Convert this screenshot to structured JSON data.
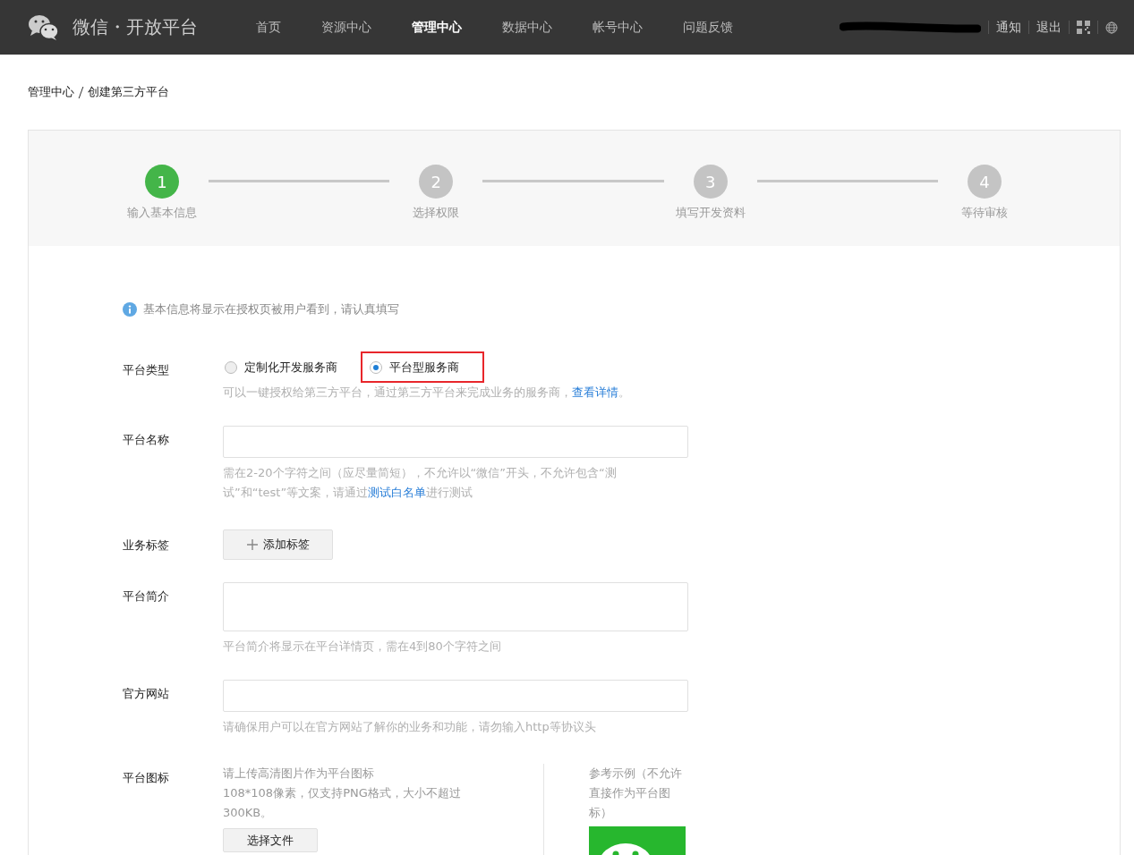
{
  "header": {
    "brand": "微信・开放平台",
    "nav": [
      {
        "label": "首页",
        "selected": false
      },
      {
        "label": "资源中心",
        "selected": false
      },
      {
        "label": "管理中心",
        "selected": true
      },
      {
        "label": "数据中心",
        "selected": false
      },
      {
        "label": "帐号中心",
        "selected": false
      },
      {
        "label": "问题反馈",
        "selected": false
      }
    ],
    "links": [
      "通知",
      "退出"
    ]
  },
  "breadcrumb": [
    "管理中心",
    "创建第三方平台"
  ],
  "steps": [
    {
      "number": "1",
      "label": "输入基本信息",
      "selected": true
    },
    {
      "number": "2",
      "label": "选择权限",
      "selected": false
    },
    {
      "number": "3",
      "label": "填写开发资料",
      "selected": false
    },
    {
      "number": "4",
      "label": "等待审核",
      "selected": false
    }
  ],
  "notice": "基本信息将显示在授权页被用户看到，请认真填写",
  "fields": [
    {
      "kind": "radio",
      "label": "平台类型",
      "options": [
        {
          "label": "定制化开发服务商",
          "selected": false,
          "highlighted": false
        },
        {
          "label": "平台型服务商",
          "selected": true,
          "highlighted": true
        }
      ],
      "hint": [
        {
          "text": "可以一键授权给第三方平台，通过第三方平台来完成业务的服务商，",
          "link": false
        },
        {
          "text": "查看详情",
          "link": true
        },
        {
          "text": "。",
          "link": false
        }
      ]
    },
    {
      "kind": "input",
      "label": "平台名称",
      "hint": [
        {
          "text": "需在2-20个字符之间（应尽量简短），不允许以“微信”开头，不允许包含“测试”和“test”等文案，请通过",
          "link": false
        },
        {
          "text": "测试白名单",
          "link": true
        },
        {
          "text": "进行测试",
          "link": false
        }
      ]
    },
    {
      "kind": "tags",
      "label": "业务标签",
      "button": "添加标签"
    },
    {
      "kind": "textarea",
      "label": "平台简介",
      "hint": [
        {
          "text": "平台简介将显示在平台详情页，需在4到80个字符之间",
          "link": false
        }
      ]
    },
    {
      "kind": "input",
      "label": "官方网站",
      "hint": [
        {
          "text": "请确保用户可以在官方网站了解你的业务和功能，请勿输入http等协议头",
          "link": false
        }
      ]
    },
    {
      "kind": "upload",
      "label": "平台图标",
      "lines": [
        "请上传高清图片作为平台图标",
        "108*108像素，仅支持PNG格式，大小不超过300KB。"
      ],
      "button": "选择文件",
      "example": "参考示例（不允许直接作为平台图标）"
    }
  ]
}
